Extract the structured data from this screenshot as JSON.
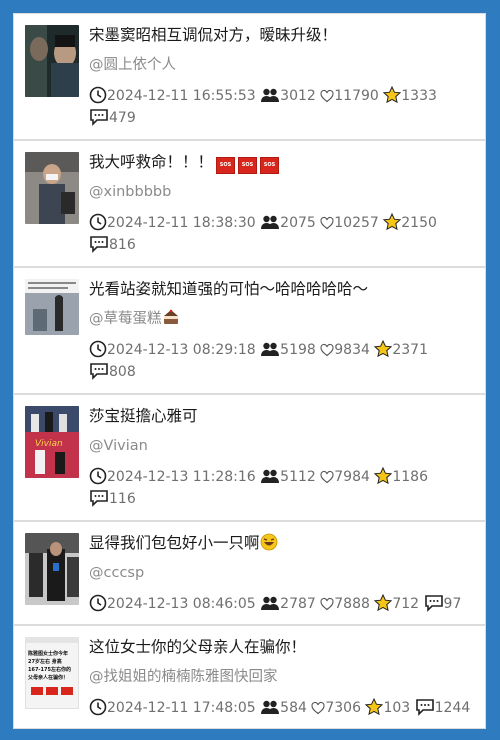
{
  "posts": [
    {
      "title": "宋墨窦昭相互调侃对方，暧昧升级！",
      "author": "@圆上依个人",
      "time": "2024-12-11 16:55:53",
      "views": "3012",
      "likes": "11790",
      "favorites": "1333",
      "comments": "479"
    },
    {
      "title": "我大呼救命！！！",
      "author": "@xinbbbbb",
      "time": "2024-12-11 18:38:30",
      "views": "2075",
      "likes": "10257",
      "favorites": "2150",
      "comments": "816",
      "badges": [
        "SOS",
        "SOS",
        "SOS"
      ]
    },
    {
      "title": "光看站姿就知道强的可怕～哈哈哈哈哈～",
      "author": "@草莓蛋糕",
      "time": "2024-12-13 08:29:18",
      "views": "5198",
      "likes": "9834",
      "favorites": "2371",
      "comments": "808"
    },
    {
      "title": "莎宝挺擔心雅可",
      "author": "@Vivian",
      "time": "2024-12-13 11:28:16",
      "views": "5112",
      "likes": "7984",
      "favorites": "1186",
      "comments": "116",
      "thumb_text": "Vivian"
    },
    {
      "title": "显得我们包包好小一只啊",
      "author": "@cccsp",
      "time": "2024-12-13 08:46:05",
      "views": "2787",
      "likes": "7888",
      "favorites": "712",
      "comments": "97"
    },
    {
      "title": "这位女士你的父母亲人在骗你！",
      "author": "@找姐姐的楠楠陈雅图快回家",
      "time": "2024-12-11 17:48:05",
      "views": "584",
      "likes": "7306",
      "favorites": "103",
      "comments": "1244",
      "thumb_lines": [
        "陈雅图女士你今年",
        "27岁左右 身高",
        "167-175左右你的",
        "父母亲人在骗你！"
      ]
    }
  ],
  "colors": {
    "background": "#2f7bbf",
    "star": "#f5c518",
    "sos": "#d9261c"
  },
  "icons": {
    "time": "clock-icon",
    "views": "users-icon",
    "likes": "heart-icon",
    "favorites": "star-icon",
    "comments": "comment-icon"
  }
}
